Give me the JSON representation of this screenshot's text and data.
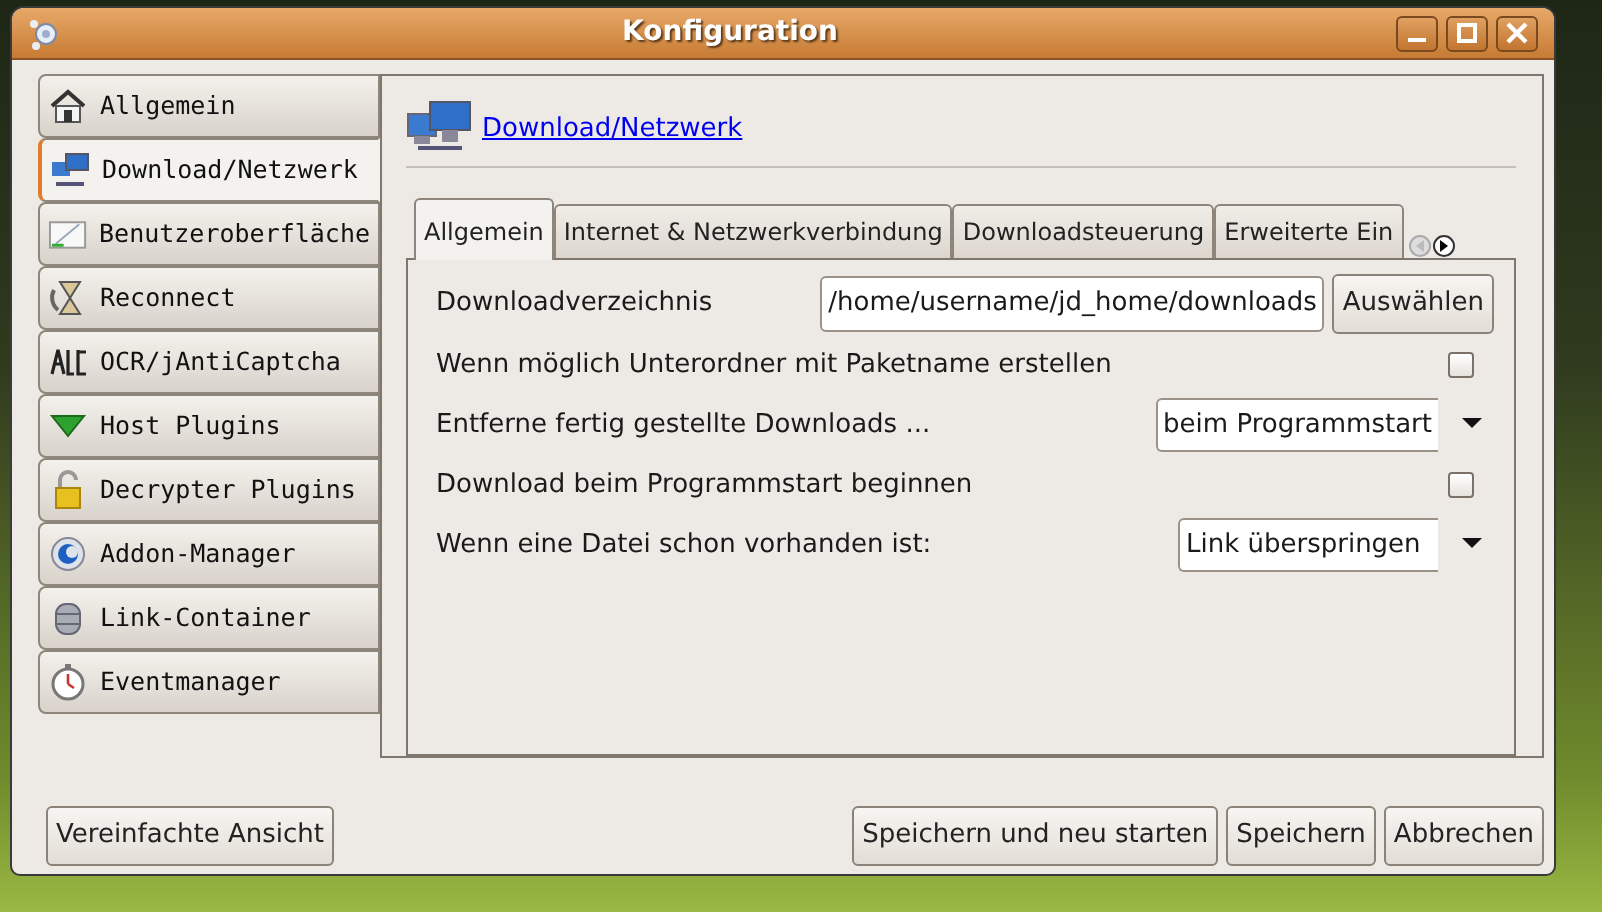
{
  "window": {
    "title": "Konfiguration"
  },
  "sidebar": {
    "items": [
      {
        "label": "Allgemein",
        "selected": false
      },
      {
        "label": "Download/Netzwerk",
        "selected": true
      },
      {
        "label": "Benutzeroberfläche",
        "selected": false
      },
      {
        "label": "Reconnect",
        "selected": false
      },
      {
        "label": "OCR/jAntiCaptcha",
        "selected": false
      },
      {
        "label": "Host Plugins",
        "selected": false
      },
      {
        "label": "Decrypter Plugins",
        "selected": false
      },
      {
        "label": "Addon-Manager",
        "selected": false
      },
      {
        "label": "Link-Container",
        "selected": false
      },
      {
        "label": "Eventmanager",
        "selected": false
      }
    ]
  },
  "header": {
    "link": "Download/Netzwerk"
  },
  "tabs": [
    {
      "label": "Allgemein",
      "selected": true
    },
    {
      "label": "Internet & Netzwerkverbindung",
      "selected": false
    },
    {
      "label": "Downloadsteuerung",
      "selected": false
    },
    {
      "label": "Erweiterte Ein",
      "selected": false
    }
  ],
  "settings": [
    {
      "kind": "path",
      "label": "Downloadverzeichnis",
      "value": "/home/username/jd_home/downloads",
      "button": "Auswählen"
    },
    {
      "kind": "checkbox",
      "label": "Wenn möglich Unterordner mit Paketname erstellen",
      "checked": false
    },
    {
      "kind": "select",
      "label": "Entferne fertig gestellte Downloads ...",
      "value": "beim Programmstart"
    },
    {
      "kind": "checkbox",
      "label": "Download beim Programmstart beginnen",
      "checked": false
    },
    {
      "kind": "select",
      "label": "Wenn eine Datei schon vorhanden ist:",
      "value": "Link überspringen"
    }
  ],
  "buttons": {
    "left": "Vereinfachte Ansicht",
    "right": [
      "Speichern und neu starten",
      "Speichern",
      "Abbrechen"
    ]
  }
}
